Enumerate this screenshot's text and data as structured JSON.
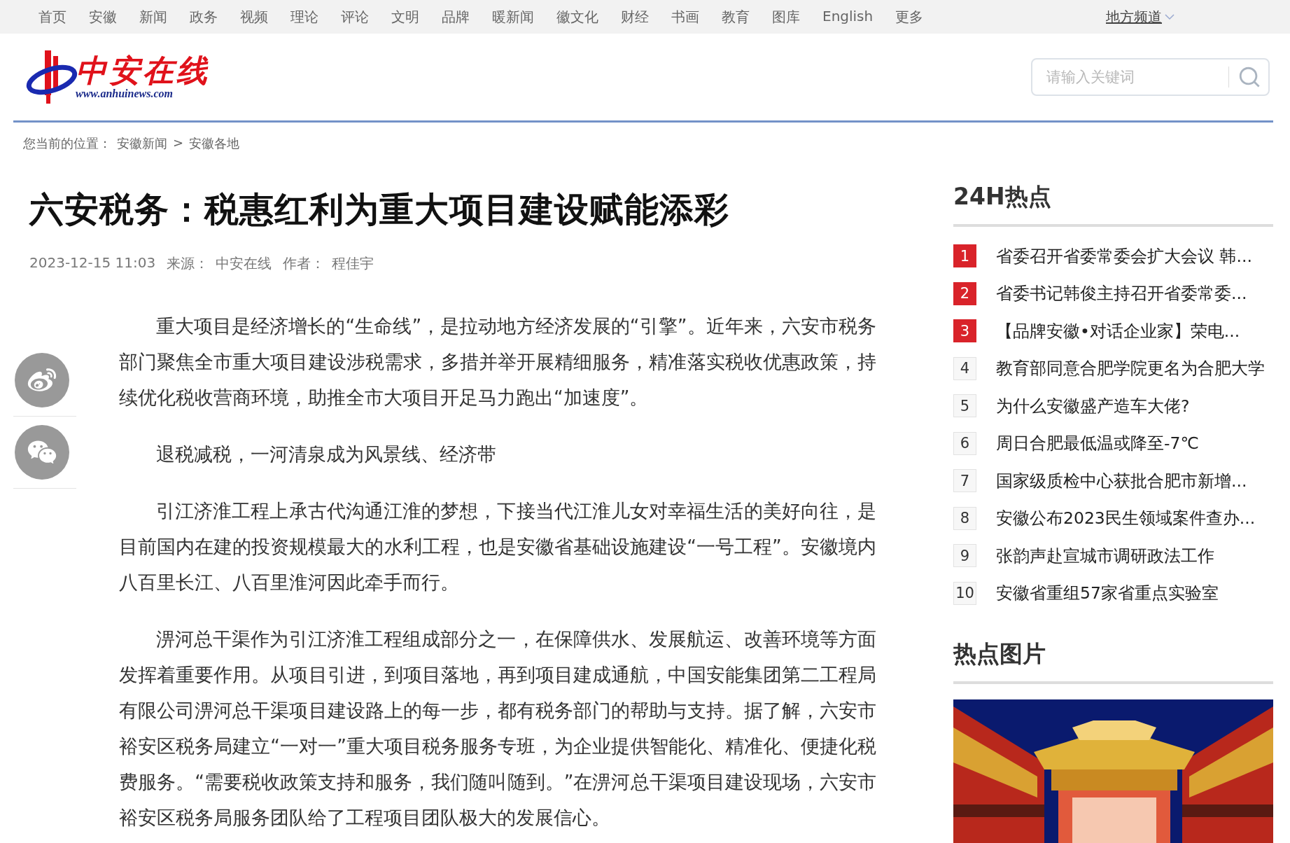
{
  "top_nav": {
    "items": [
      "首页",
      "安徽",
      "新闻",
      "政务",
      "视频",
      "理论",
      "评论",
      "文明",
      "品牌",
      "暖新闻",
      "徽文化",
      "财经",
      "书画",
      "教育",
      "图库",
      "English",
      "更多"
    ],
    "regional": "地方频道"
  },
  "logo": {
    "name": "中安在线",
    "url": "www.anhuinews.com"
  },
  "search": {
    "placeholder": "请输入关键词"
  },
  "breadcrumb": {
    "label": "您当前的位置：",
    "items": [
      "安徽新闻",
      "安徽各地"
    ],
    "separator": ">"
  },
  "article": {
    "title": "六安税务：税惠红利为重大项目建设赋能添彩",
    "meta": {
      "date": "2023-12-15 11:03",
      "source_label": "来源：",
      "source": "中安在线",
      "author_label": "作者：",
      "author": "程佳宇"
    },
    "paragraphs": [
      "重大项目是经济增长的“生命线”，是拉动地方经济发展的“引擎”。近年来，六安市税务部门聚焦全市重大项目建设涉税需求，多措并举开展精细服务，精准落实税收优惠政策，持续优化税收营商环境，助推全市大项目开足马力跑出“加速度”。",
      "退税减税，一河清泉成为风景线、经济带",
      "引江济淮工程上承古代沟通江淮的梦想，下接当代江淮儿女对幸福生活的美好向往，是目前国内在建的投资规模最大的水利工程，也是安徽省基础设施建设“一号工程”。安徽境内八百里长江、八百里淮河因此牵手而行。",
      "淠河总干渠作为引江济淮工程组成部分之一，在保障供水、发展航运、改善环境等方面发挥着重要作用。从项目引进，到项目落地，再到项目建成通航，中国安能集团第二工程局有限公司淠河总干渠项目建设路上的每一步，都有税务部门的帮助与支持。据了解，六安市裕安区税务局建立“一对一”重大项目税务服务专班，为企业提供智能化、精准化、便捷化税费服务。“需要税收政策支持和服务，我们随叫随到。”在淠河总干渠项目建设现场，六安市裕安区税务局服务团队给了工程项目团队极大的发展信心。"
    ]
  },
  "share": [
    {
      "kind": "weibo"
    },
    {
      "kind": "wechat"
    }
  ],
  "hot_list": {
    "title": "24H热点",
    "items": [
      {
        "rank": "1",
        "title": "省委召开省委常委会扩大会议 韩...",
        "highlighted": true
      },
      {
        "rank": "2",
        "title": "省委书记韩俊主持召开省委常委...",
        "highlighted": true
      },
      {
        "rank": "3",
        "title": "【品牌安徽•对话企业家】荣电...",
        "highlighted": true
      },
      {
        "rank": "4",
        "title": "教育部同意合肥学院更名为合肥大学",
        "highlighted": false
      },
      {
        "rank": "5",
        "title": "为什么安徽盛产造车大佬?",
        "highlighted": false
      },
      {
        "rank": "6",
        "title": "周日合肥最低温或降至-7℃",
        "highlighted": false
      },
      {
        "rank": "7",
        "title": "国家级质检中心获批合肥市新增...",
        "highlighted": false
      },
      {
        "rank": "8",
        "title": "安徽公布2023民生领域案件查办...",
        "highlighted": false
      },
      {
        "rank": "9",
        "title": "张韵声赴宣城市调研政法工作",
        "highlighted": false
      },
      {
        "rank": "10",
        "title": "安徽省重组57家省重点实验室",
        "highlighted": false
      }
    ]
  },
  "hot_pictures": {
    "title": "热点图片"
  }
}
